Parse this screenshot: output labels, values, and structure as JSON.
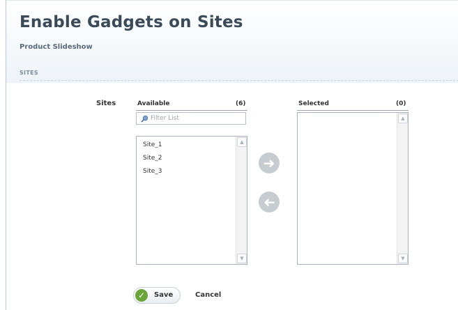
{
  "header": {
    "title": "Enable Gadgets on Sites",
    "subtitle": "Product Slideshow"
  },
  "section": {
    "label": "SITES"
  },
  "form": {
    "field_label": "Sites",
    "available": {
      "heading": "Available",
      "count": "(6)",
      "filter_placeholder": "Filter List",
      "items": [
        "Site_1",
        "Site_2",
        "Site_3"
      ]
    },
    "selected": {
      "heading": "Selected",
      "count": "(0)",
      "items": []
    },
    "move_right_icon": "arrow-right",
    "move_left_icon": "arrow-left"
  },
  "actions": {
    "save_label": "Save",
    "cancel_label": "Cancel"
  },
  "colors": {
    "title": "#3a4a58",
    "save_check": "#6aa53a",
    "arrow_button": "#c7ccd0"
  }
}
